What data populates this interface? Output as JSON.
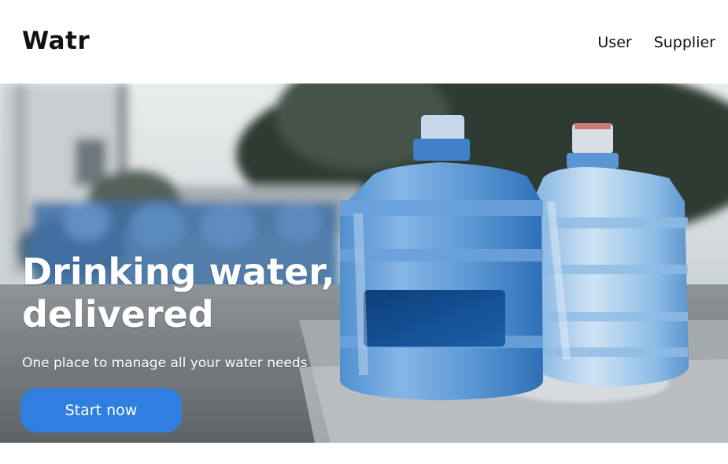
{
  "header": {
    "logo": "Watr",
    "nav": [
      {
        "label": "User"
      },
      {
        "label": "Supplier"
      }
    ]
  },
  "hero": {
    "title": "Drinking water,\ndelivered",
    "subtitle": "One place to manage all your water needs",
    "cta_label": "Start now",
    "image_description_icon": "water-jugs-photo"
  },
  "colors": {
    "accent": "#2f7fe0",
    "text": "#111111",
    "background": "#ffffff"
  }
}
